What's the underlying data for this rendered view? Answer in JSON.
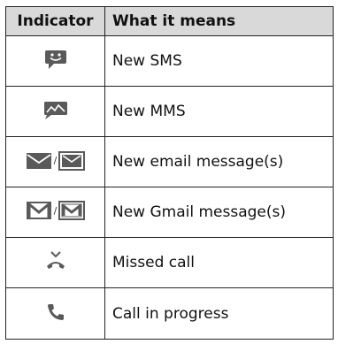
{
  "table": {
    "headers": {
      "indicator": "Indicator",
      "meaning": "What it means"
    },
    "icon_separator": "/",
    "rows": [
      {
        "icons": [
          "sms-smiley-bubble-icon"
        ],
        "meaning": "New SMS"
      },
      {
        "icons": [
          "mms-picture-bubble-icon"
        ],
        "meaning": "New MMS"
      },
      {
        "icons": [
          "email-envelope-icon",
          "email-envelope-outline-icon"
        ],
        "meaning": "New email message(s)"
      },
      {
        "icons": [
          "gmail-icon",
          "gmail-outline-icon"
        ],
        "meaning": "New Gmail message(s)"
      },
      {
        "icons": [
          "missed-call-icon"
        ],
        "meaning": "Missed call"
      },
      {
        "icons": [
          "phone-handset-icon"
        ],
        "meaning": "Call in progress"
      }
    ]
  },
  "colors": {
    "header_bg": "#d9d9d9",
    "border": "#222222",
    "icon_gray": "#5a5a5a"
  }
}
